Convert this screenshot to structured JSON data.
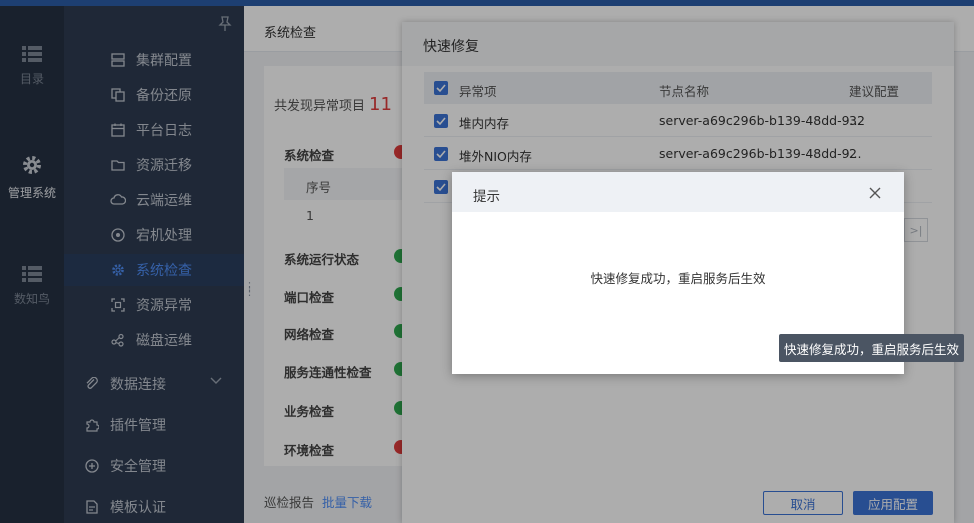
{
  "rail": {
    "items": [
      {
        "label": "目录",
        "icon": "list-icon"
      },
      {
        "label": "管理系统",
        "icon": "gear-icon"
      },
      {
        "label": "数知鸟",
        "icon": "list-icon"
      }
    ]
  },
  "menu": {
    "sub_items": [
      {
        "label": "集群配置",
        "icon": "server-icon"
      },
      {
        "label": "备份还原",
        "icon": "copy-icon"
      },
      {
        "label": "平台日志",
        "icon": "calendar-icon"
      },
      {
        "label": "资源迁移",
        "icon": "folder-icon"
      },
      {
        "label": "云端运维",
        "icon": "cloud-icon"
      },
      {
        "label": "宕机处理",
        "icon": "power-icon"
      },
      {
        "label": "系统检查",
        "icon": "gear-icon"
      },
      {
        "label": "资源异常",
        "icon": "scan-icon"
      },
      {
        "label": "磁盘运维",
        "icon": "share-icon"
      }
    ],
    "top_items": [
      {
        "label": "数据连接",
        "icon": "link-icon"
      },
      {
        "label": "插件管理",
        "icon": "puzzle-icon"
      },
      {
        "label": "安全管理",
        "icon": "shield-icon"
      },
      {
        "label": "模板认证",
        "icon": "file-icon"
      }
    ]
  },
  "main": {
    "title": "系统检查",
    "found_label": "共发现异常项目",
    "found_count": "11",
    "sections": [
      {
        "label": "系统检查",
        "status": "error"
      },
      {
        "label": "系统运行状态",
        "status": "ok"
      },
      {
        "label": "端口检查",
        "status": "ok"
      },
      {
        "label": "网络检查",
        "status": "ok"
      },
      {
        "label": "服务连通性检查",
        "status": "ok"
      },
      {
        "label": "业务检查",
        "status": "ok"
      },
      {
        "label": "环境检查",
        "status": "error"
      }
    ],
    "table_header": "序号",
    "table_cell": "1",
    "footer_label": "巡检报告",
    "footer_link": "批量下载"
  },
  "drawer": {
    "title": "快速修复",
    "columns": [
      "异常项",
      "节点名称",
      "建议配置"
    ],
    "rows": [
      {
        "item": "堆内内存",
        "node": "server-a69c296b-b139-48dd-9...",
        "value": "32"
      },
      {
        "item": "堆外NIO内存",
        "node": "server-a69c296b-b139-48dd-9...",
        "value": "2"
      }
    ],
    "pager_last": ">|",
    "cancel_label": "取消",
    "apply_label": "应用配置"
  },
  "dialog": {
    "title": "提示",
    "message": "快速修复成功，重启服务后生效"
  },
  "tooltip": "快速修复成功，重启服务后生效",
  "colors": {
    "accent": "#3b73d6",
    "ok": "#2fa84f",
    "error": "#e03c3c"
  }
}
